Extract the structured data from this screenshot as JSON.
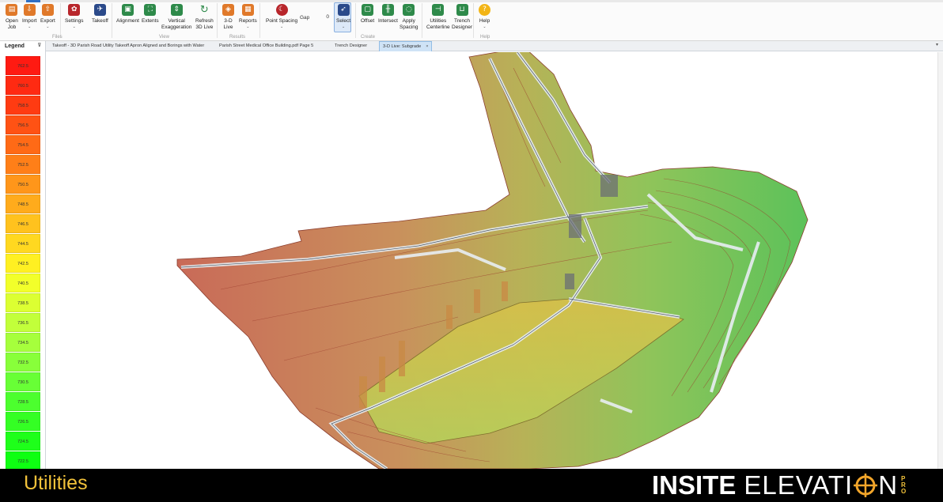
{
  "ribbon": {
    "buttons": {
      "open_job": "Open\nJob",
      "import": "Import",
      "export": "Export",
      "settings": "Settings",
      "takeoff": "Takeoff",
      "alignment": "Alignment",
      "extents": "Extents",
      "vertical_exaggeration": "Vertical\nExaggeration",
      "refresh_3d_live": "Refresh\n3D Live",
      "live_3d": "3-D\nLive",
      "reports": "Reports",
      "point_spacing": "Point Spacing",
      "gap": "Gap",
      "gap_value": "0",
      "select": "Select",
      "offset": "Offset",
      "intersect": "Intersect",
      "apply_spacing": "Apply\nSpacing",
      "utilities_centerline": "Utilities\nCenterline",
      "trench_designer": "Trench\nDesigner",
      "help": "Help"
    },
    "groups": {
      "files": "Files",
      "view": "View",
      "results": "Results",
      "create": "Create",
      "help": "Help"
    }
  },
  "legend": {
    "title": "Legend",
    "entries": [
      "762.5",
      "760.5",
      "758.5",
      "756.5",
      "754.5",
      "752.5",
      "750.5",
      "748.5",
      "746.5",
      "744.5",
      "742.5",
      "740.5",
      "738.5",
      "736.5",
      "734.5",
      "732.5",
      "730.5",
      "728.5",
      "726.5",
      "724.5",
      "722.5"
    ],
    "colors": [
      "#ff1a12",
      "#ff2a12",
      "#ff3b12",
      "#ff5214",
      "#ff6a16",
      "#ff7f18",
      "#ff961a",
      "#ffab1c",
      "#ffc21e",
      "#ffd820",
      "#fff022",
      "#f2ff2a",
      "#dcff32",
      "#c2ff3a",
      "#a6ff3c",
      "#88ff3a",
      "#68ff36",
      "#4cff2e",
      "#34ff24",
      "#1eff1a",
      "#0eff12"
    ]
  },
  "tabs": [
    {
      "label": "Takeoff - 3D Parish Road Utility Takeoff Apron Aligned and Borings with Water"
    },
    {
      "label": "Parish Street Medical Office Building.pdf Page 5"
    },
    {
      "label": "Trench Designer"
    },
    {
      "label": "3-D Live: Subgrade",
      "active": true,
      "close": "×"
    }
  ],
  "banner": {
    "title": "Utilities",
    "brand_bold": "INSITE",
    "brand_light_a": "ELEVATI",
    "brand_light_b": "N",
    "brand_tag": [
      "P",
      "R",
      "O"
    ]
  }
}
